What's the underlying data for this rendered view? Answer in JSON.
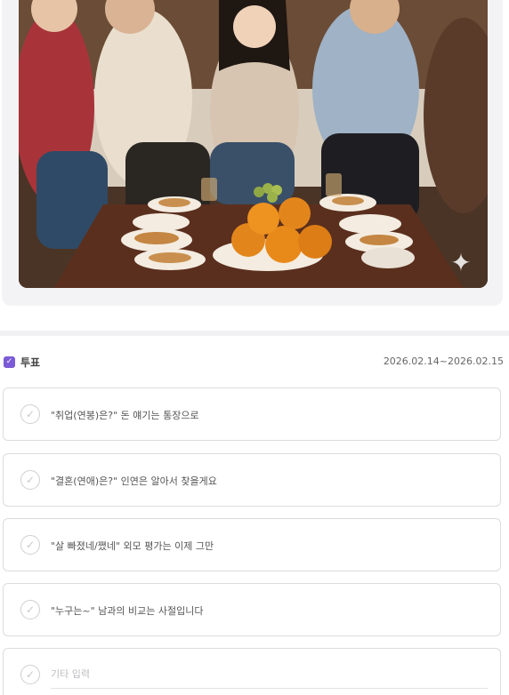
{
  "image": {
    "alt_icon": "sparkle-icon",
    "sparkle_glyph": "✦"
  },
  "vote": {
    "icon": "checkbox-icon",
    "icon_glyph": "✓",
    "title": "투표",
    "period": "2026.02.14~2026.02.15",
    "check_glyph": "✓",
    "options": [
      {
        "label": "\"취업(연봉)은?\" 돈 얘기는 통장으로"
      },
      {
        "label": "\"결혼(연애)은?\" 인연은 알아서 찾을게요"
      },
      {
        "label": "\"살 빠졌네/쪘네\" 외모 평가는 이제 그만"
      },
      {
        "label": "\"누구는~\" 남과의 비교는 사절입니다"
      }
    ],
    "other_placeholder": "기타 입력"
  },
  "colors": {
    "accent": "#7b5bd6",
    "border": "#dcdcdf",
    "background": "#f3f3f5"
  }
}
